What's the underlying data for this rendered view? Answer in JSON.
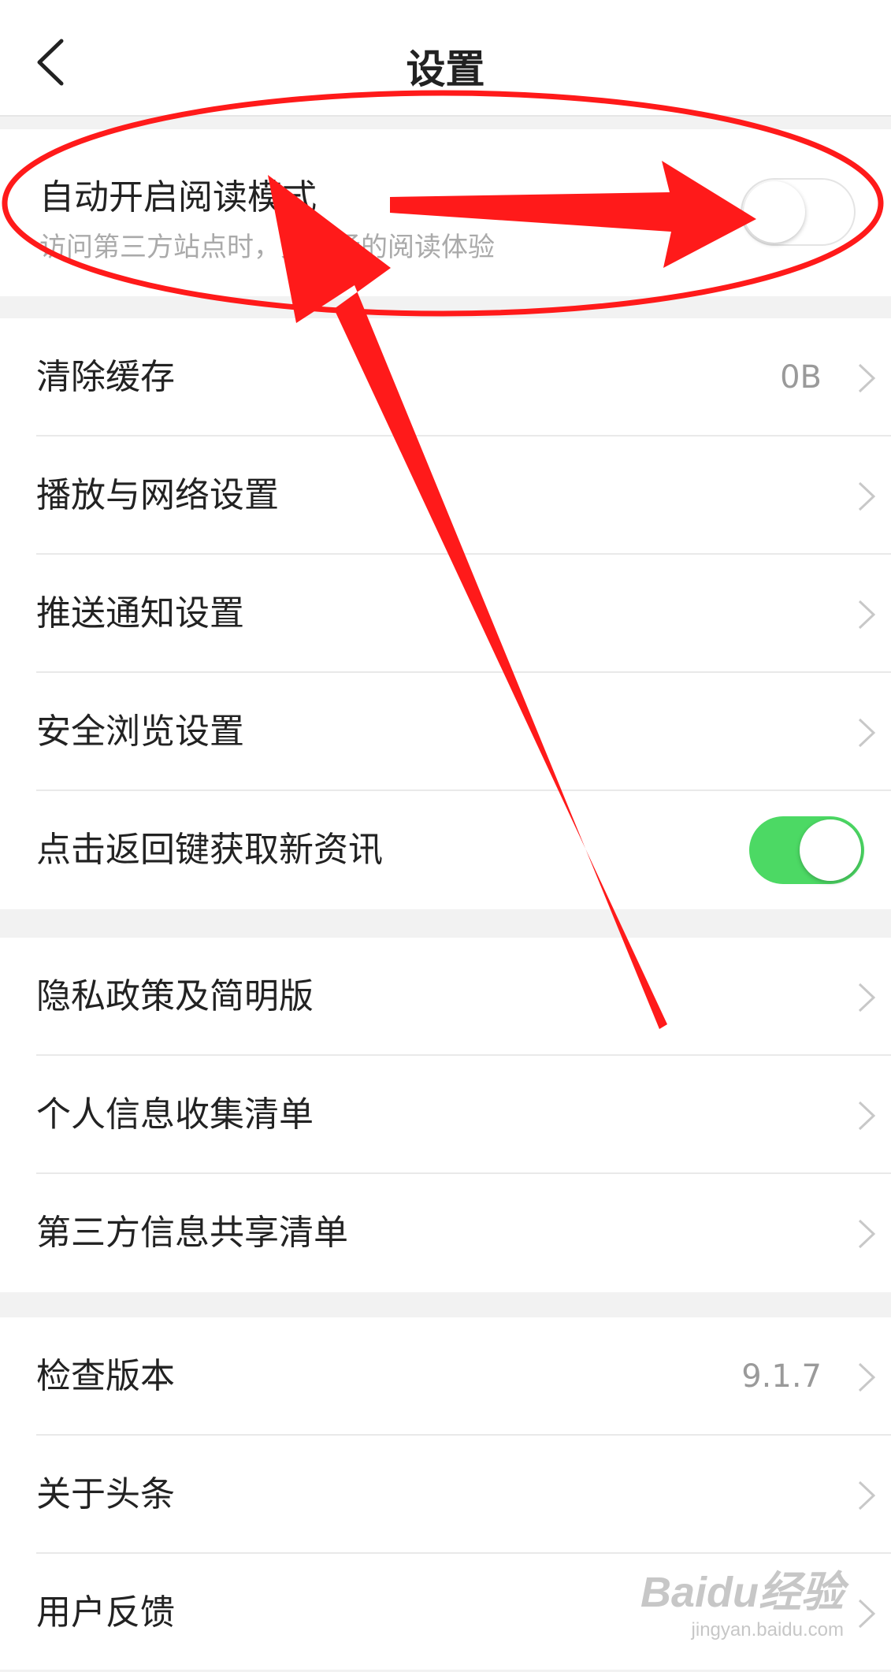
{
  "header": {
    "title": "设置"
  },
  "reading_mode": {
    "label": "自动开启阅读模式",
    "sublabel": "访问第三方站点时，更流畅的阅读体验",
    "enabled": false
  },
  "group1": [
    {
      "label": "清除缓存",
      "value": "0B"
    },
    {
      "label": "播放与网络设置"
    },
    {
      "label": "推送通知设置"
    },
    {
      "label": "安全浏览设置"
    },
    {
      "label": "点击返回键获取新资讯",
      "toggle_enabled": true
    }
  ],
  "group2": [
    {
      "label": "隐私政策及简明版"
    },
    {
      "label": "个人信息收集清单"
    },
    {
      "label": "第三方信息共享清单"
    }
  ],
  "group3": [
    {
      "label": "检查版本",
      "value": "9.1.7"
    },
    {
      "label": "关于头条"
    },
    {
      "label": "用户反馈"
    }
  ],
  "watermark": {
    "logo": "Baidu经验",
    "url": "jingyan.baidu.com"
  },
  "colors": {
    "toggle_on": "#4cd964",
    "annotation_red": "#ff1a1a",
    "background": "#f2f2f2"
  }
}
